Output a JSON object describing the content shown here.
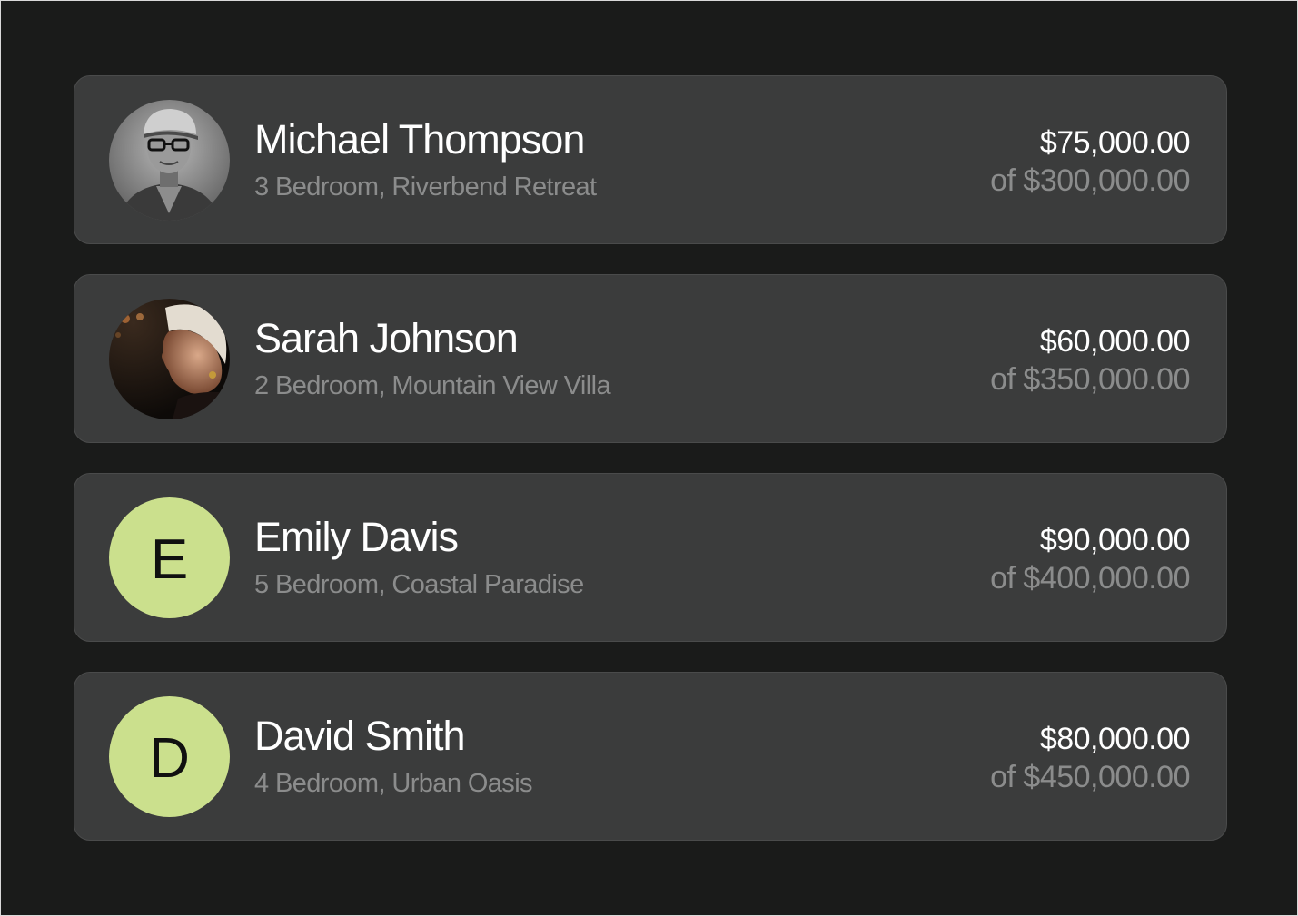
{
  "colors": {
    "background": "#1a1b1a",
    "card": "#3b3c3c",
    "initial_avatar": "#cbe08d",
    "primary_text": "#ffffff",
    "secondary_text": "#8b8c8c"
  },
  "buyers": [
    {
      "name": "Michael Thompson",
      "property": "3 Bedroom, Riverbend Retreat",
      "amount": "$75,000.00",
      "total": "of $300,000.00",
      "avatar": "photo-avatar"
    },
    {
      "name": "Sarah Johnson",
      "property": "2 Bedroom, Mountain View Villa",
      "amount": "$60,000.00",
      "total": "of $350,000.00",
      "avatar": "photo-avatar"
    },
    {
      "name": "Emily Davis",
      "property": "5 Bedroom, Coastal Paradise",
      "amount": "$90,000.00",
      "total": "of $400,000.00",
      "initial": "E"
    },
    {
      "name": "David Smith",
      "property": "4 Bedroom, Urban Oasis",
      "amount": "$80,000.00",
      "total": "of $450,000.00",
      "initial": "D"
    }
  ]
}
